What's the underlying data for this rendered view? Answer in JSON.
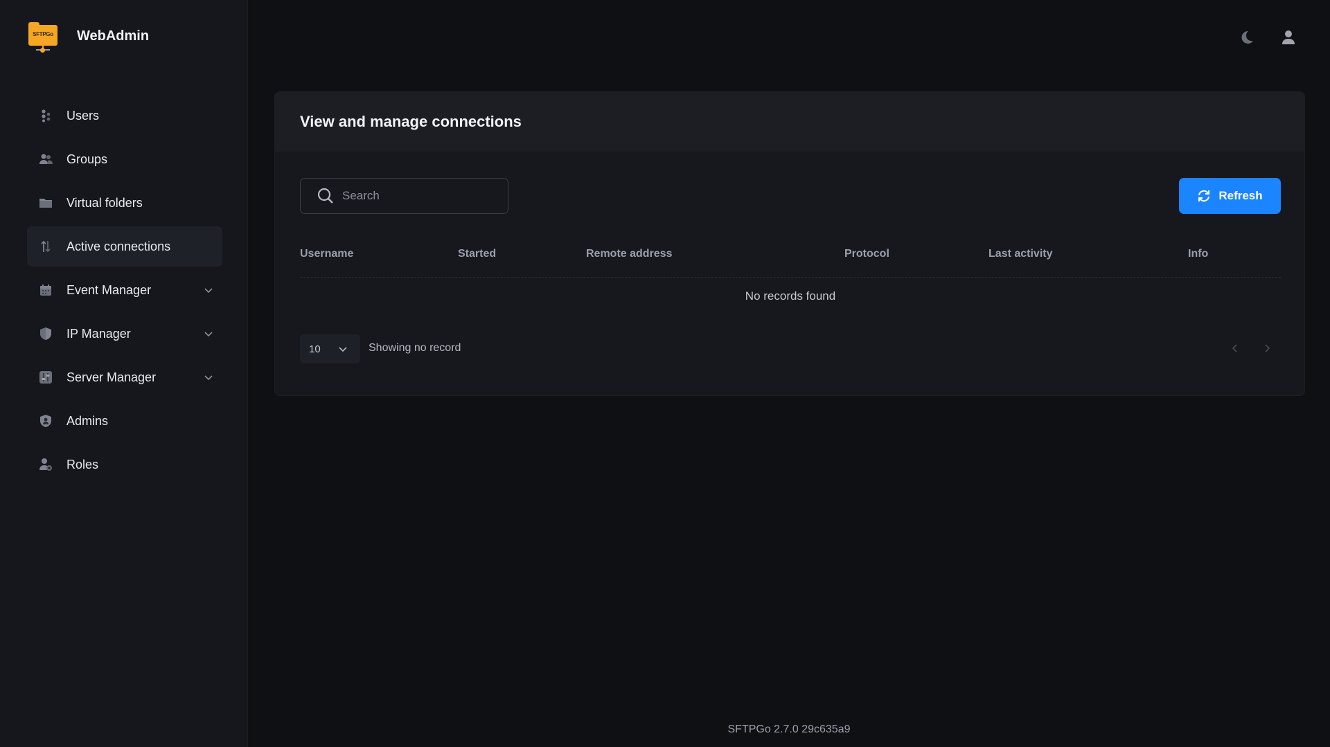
{
  "brand": {
    "logo_text": "SFTPGo",
    "title": "WebAdmin"
  },
  "sidebar": {
    "items": [
      {
        "label": "Users",
        "icon": "users-icon",
        "active": false,
        "expandable": false
      },
      {
        "label": "Groups",
        "icon": "groups-icon",
        "active": false,
        "expandable": false
      },
      {
        "label": "Virtual folders",
        "icon": "folder-icon",
        "active": false,
        "expandable": false
      },
      {
        "label": "Active connections",
        "icon": "arrows-updown-icon",
        "active": true,
        "expandable": false
      },
      {
        "label": "Event Manager",
        "icon": "calendar-icon",
        "active": false,
        "expandable": true
      },
      {
        "label": "IP Manager",
        "icon": "shield-icon",
        "active": false,
        "expandable": true
      },
      {
        "label": "Server Manager",
        "icon": "sliders-icon",
        "active": false,
        "expandable": true
      },
      {
        "label": "Admins",
        "icon": "admin-shield-icon",
        "active": false,
        "expandable": false
      },
      {
        "label": "Roles",
        "icon": "user-gear-icon",
        "active": false,
        "expandable": false
      }
    ]
  },
  "header": {
    "theme_icon": "moon-icon",
    "user_icon": "user-icon"
  },
  "main": {
    "card_title": "View and manage connections",
    "search": {
      "placeholder": "Search",
      "value": ""
    },
    "refresh_label": "Refresh",
    "table": {
      "columns": [
        "Username",
        "Started",
        "Remote address",
        "Protocol",
        "Last activity",
        "Info"
      ],
      "rows": [],
      "empty_text": "No records found"
    },
    "pagination": {
      "page_size": "10",
      "summary": "Showing no record"
    }
  },
  "footer": {
    "version": "SFTPGo 2.7.0 29c635a9"
  },
  "colors": {
    "accent": "#1b84ff",
    "logo": "#f5a623",
    "background": "#0f1014",
    "sidebar": "#15171c"
  }
}
